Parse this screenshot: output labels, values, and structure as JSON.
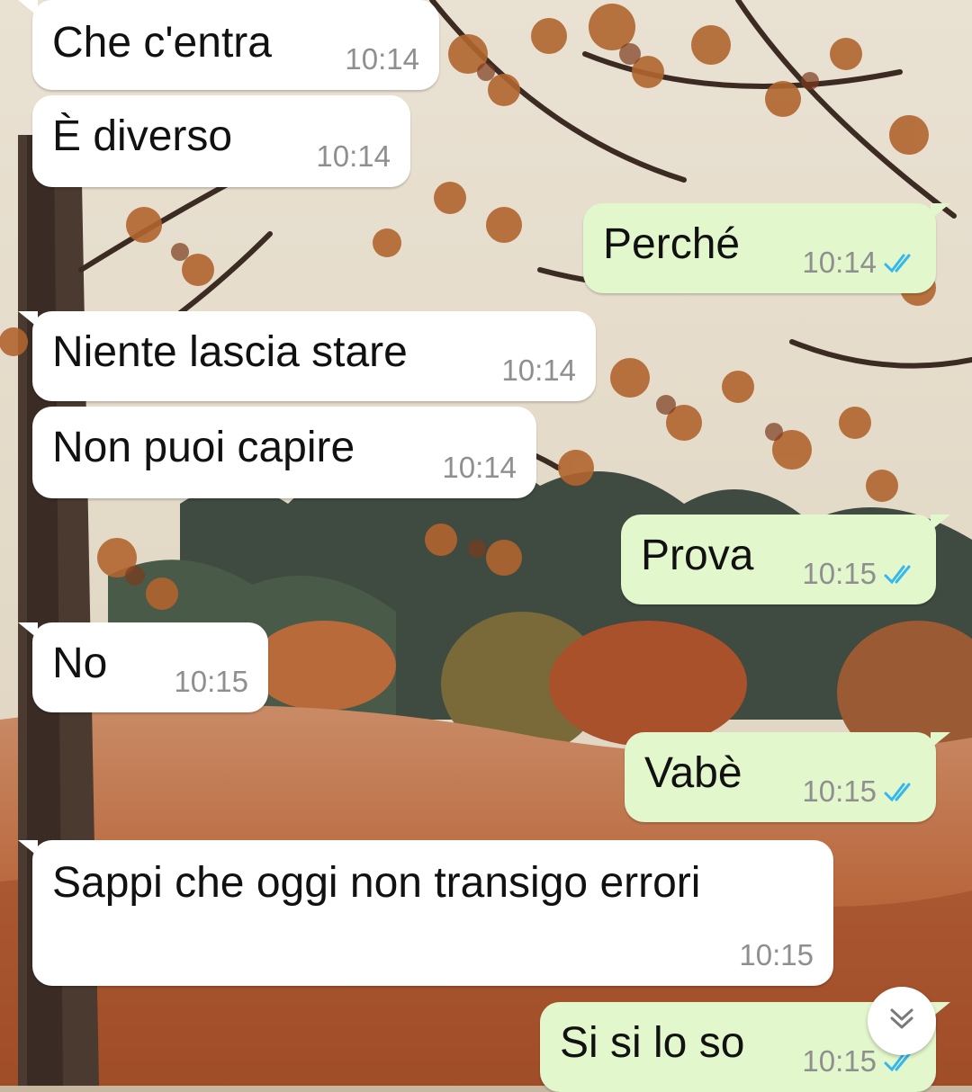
{
  "colors": {
    "incoming_bubble": "#ffffff",
    "outgoing_bubble": "#e2f7cb",
    "read_ticks": "#34b7f1",
    "timestamp": "#8f8f8f"
  },
  "messages": [
    {
      "direction": "in",
      "text": "Che c'entra",
      "time": "10:14"
    },
    {
      "direction": "in",
      "text": "È diverso",
      "time": "10:14"
    },
    {
      "direction": "out",
      "text": "Perché",
      "time": "10:14",
      "status_icon": "double-check-read-icon"
    },
    {
      "direction": "in",
      "text": "Niente lascia stare",
      "time": "10:14"
    },
    {
      "direction": "in",
      "text": "Non puoi capire",
      "time": "10:14"
    },
    {
      "direction": "out",
      "text": "Prova",
      "time": "10:15",
      "status_icon": "double-check-read-icon"
    },
    {
      "direction": "in",
      "text": "No",
      "time": "10:15"
    },
    {
      "direction": "out",
      "text": "Vabè",
      "time": "10:15",
      "status_icon": "double-check-read-icon"
    },
    {
      "direction": "in",
      "text": "Sappi che oggi non transigo errori",
      "time": "10:15"
    },
    {
      "direction": "out",
      "text": "Si si lo so",
      "time": "10:15",
      "status_icon": "double-check-read-icon"
    }
  ],
  "scroll_button_icon": "double-chevron-down-icon"
}
